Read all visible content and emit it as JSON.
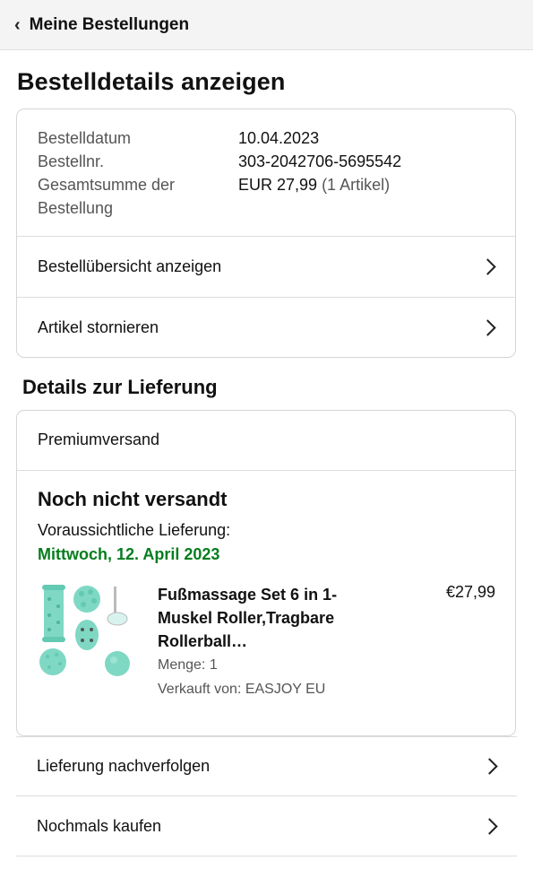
{
  "header": {
    "back_label": "Meine Bestellungen"
  },
  "page": {
    "title": "Bestelldetails anzeigen"
  },
  "order_info": [
    {
      "label": "Bestelldatum",
      "value": "10.04.2023",
      "extra": ""
    },
    {
      "label": "Bestellnr.",
      "value": "303-2042706-5695542",
      "extra": ""
    },
    {
      "label": "Gesamtsumme der",
      "value": "EUR 27,99",
      "extra": " (1 Artikel)"
    },
    {
      "label": "Bestellung",
      "value": "",
      "extra": ""
    }
  ],
  "order_actions": [
    {
      "label": "Bestellübersicht anzeigen"
    },
    {
      "label": "Artikel stornieren"
    }
  ],
  "delivery": {
    "section_title": "Details zur Lieferung",
    "shipping_method": "Premiumversand",
    "status": "Noch nicht versandt",
    "eta_label": "Voraussichtliche Lieferung:",
    "eta_date": "Mittwoch, 12. April 2023",
    "eta_color": "#067d1e",
    "product": {
      "title": "Fußmassage Set 6 in 1- Muskel Roller,Tragbare Rollerball…",
      "price": "€27,99",
      "quantity": "Menge: 1",
      "seller": "Verkauft von: EASJOY EU",
      "image_icon": "massage-roller-set-image"
    }
  },
  "bottom_actions": [
    {
      "label": "Lieferung nachverfolgen"
    },
    {
      "label": "Nochmals kaufen"
    }
  ]
}
